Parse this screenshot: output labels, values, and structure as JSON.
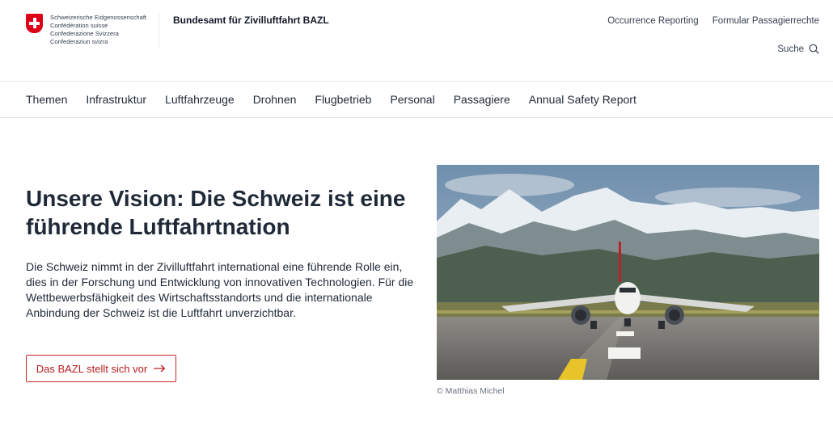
{
  "header": {
    "confederation_lines": [
      "Schweizerische Eidgenossenschaft",
      "Confédération suisse",
      "Confederazione Svizzera",
      "Confederaziun svizra"
    ],
    "office_name": "Bundesamt für Zivilluftfahrt BAZL",
    "top_links": [
      "Occurrence Reporting",
      "Formular Passagierrechte"
    ],
    "search_label": "Suche"
  },
  "nav": {
    "items": [
      "Themen",
      "Infrastruktur",
      "Luftfahrzeuge",
      "Drohnen",
      "Flugbetrieb",
      "Personal",
      "Passagiere",
      "Annual Safety Report"
    ]
  },
  "hero": {
    "headline": "Unsere Vision: Die Schweiz ist eine führende Luftfahrtnation",
    "lead": "Die Schweiz nimmt in der Zivilluftfahrt international eine führende Rolle ein, dies in der Forschung und Entwicklung von innovativen Technologien. Für die Wettbewerbsfähigkeit des Wirtschaftsstandorts und die internationale Anbindung der Schweiz ist die Luftfahrt unverzichtbar.",
    "cta_label": "Das BAZL stellt sich vor",
    "image_caption": "© Matthias Michel"
  },
  "icons": {
    "logo": "swiss-flag-icon",
    "search": "search-icon",
    "cta": "arrow-right-icon"
  },
  "colors": {
    "brand_red": "#dc0018",
    "cta_red": "#b91c1c"
  }
}
